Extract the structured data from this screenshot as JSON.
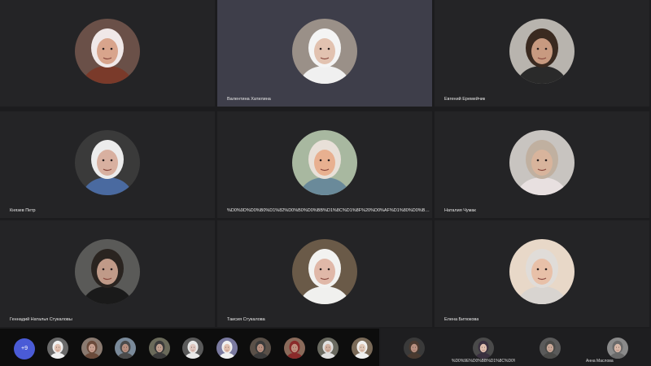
{
  "participants": [
    {
      "name": "",
      "skin": "#d8a48c",
      "head": "#f0e8e8",
      "body": "#7a3a2a",
      "bg": "#6a5048"
    },
    {
      "name": "Валентина Хатилина",
      "skin": "#e2c2b0",
      "head": "#f4f4f4",
      "body": "#f0f0f0",
      "bg": "#9a9088"
    },
    {
      "name": "Евгений Еремейчик",
      "skin": "#c89a80",
      "head": "#3a2a20",
      "body": "#2a2a2a",
      "bg": "#b8b4ae"
    },
    {
      "name": "Князев Петр",
      "skin": "#d8b0a0",
      "head": "#ececec",
      "body": "#4a6aa0",
      "bg": "#3a3a3a"
    },
    {
      "name": "%D0%9D%D0%B0%D1%82%D0%B0%D0%BB%D1%8C%D1%8F%20%D0%AF%D1%80%D0%B5%D0%BD%D0%B0...",
      "skin": "#e8b090",
      "head": "#e8e0d8",
      "body": "#6a8a9a",
      "bg": "#a8b8a0"
    },
    {
      "name": "Наталия Чумак",
      "skin": "#d8b49c",
      "head": "#c0b0a0",
      "body": "#e8e0e0",
      "bg": "#c8c4c0"
    },
    {
      "name": "Геннадий Наталья Стукаловы",
      "skin": "#c09a88",
      "head": "#2a2420",
      "body": "#1a1a1a",
      "bg": "#5a5a58"
    },
    {
      "name": "Таисия Стукалова",
      "skin": "#e0b8a8",
      "head": "#f2f2f0",
      "body": "#f0f0ee",
      "bg": "#6a5a48"
    },
    {
      "name": "Елена Битюкова",
      "skin": "#e8c0a8",
      "head": "#e0dcd8",
      "body": "#d8d4d0",
      "bg": "#e8d8c8"
    }
  ],
  "more_count": "+9",
  "thumbnails": [
    {
      "skin": "#e0c0b0",
      "head": "#f0f0f0",
      "bg": "#6a6a6a"
    },
    {
      "skin": "#c8a090",
      "head": "#6a4a3a",
      "bg": "#8a7a70"
    },
    {
      "skin": "#b89080",
      "head": "#4a4a4a",
      "bg": "#7a8a9a"
    },
    {
      "skin": "#c0a090",
      "head": "#3a3a3a",
      "bg": "#6a6a5a"
    },
    {
      "skin": "#e0c8c0",
      "head": "#e8e8e8",
      "bg": "#5a5a5a"
    },
    {
      "skin": "#e0c0b0",
      "head": "#f0f0f0",
      "bg": "#7a7aa0"
    },
    {
      "skin": "#b89080",
      "head": "#3a3a3a",
      "bg": "#5a5048"
    },
    {
      "skin": "#c09080",
      "head": "#8a2a2a",
      "bg": "#8a6a5a"
    },
    {
      "skin": "#d0b0a0",
      "head": "#e0e0e0",
      "bg": "#6a6a60"
    },
    {
      "skin": "#e0c8b8",
      "head": "#f0f0f0",
      "bg": "#7a6a58"
    }
  ],
  "bottom_right": [
    {
      "name": "",
      "skin": "#b89080",
      "head": "#4a3a30",
      "bg": "#3a3a3a"
    },
    {
      "name": "%D0%9E%D0%BB%D1%8C%D0%B3%D0%B0...",
      "skin": "#e0c0b0",
      "head": "#3a3040",
      "bg": "#4a4a4a"
    },
    {
      "name": "",
      "skin": "#c8a898",
      "head": "#4a4a48",
      "bg": "#5a5a5a"
    },
    {
      "name": "Анна Маслова",
      "skin": "#d8b8a8",
      "head": "#6a6a6a",
      "bg": "#8a8a8a"
    }
  ]
}
